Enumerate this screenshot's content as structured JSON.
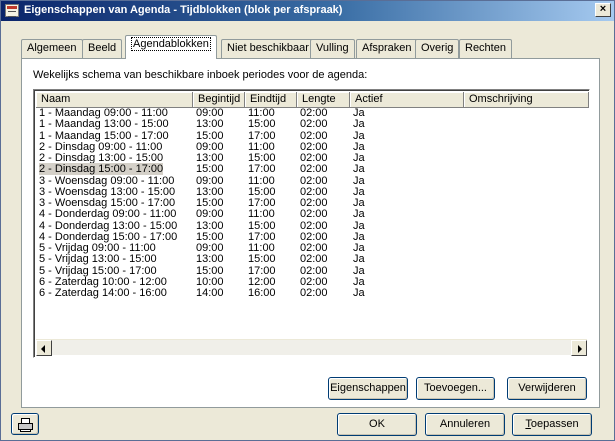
{
  "window": {
    "title": "Eigenschappen van Agenda - Tijdblokken (blok per afspraak)",
    "close_glyph": "×"
  },
  "tabs": [
    {
      "label": "Algemeen"
    },
    {
      "label": "Beeld"
    },
    {
      "label": "Agendablokken",
      "active": true
    },
    {
      "label": "Niet beschikbaar"
    },
    {
      "label": "Vulling"
    },
    {
      "label": "Afspraken"
    },
    {
      "label": "Overig"
    },
    {
      "label": "Rechten"
    }
  ],
  "panel": {
    "caption": "Wekelijks schema van beschikbare inboek periodes voor de agenda:"
  },
  "list": {
    "columns": [
      "Naam",
      "Begintijd",
      "Eindtijd",
      "Lengte",
      "Actief",
      "Omschrijving"
    ],
    "selected_row_index": 5,
    "rows": [
      [
        "1 - Maandag 09:00 - 11:00",
        "09:00",
        "11:00",
        "02:00",
        "Ja",
        ""
      ],
      [
        "1 - Maandag 13:00 - 15:00",
        "13:00",
        "15:00",
        "02:00",
        "Ja",
        ""
      ],
      [
        "1 - Maandag 15:00 - 17:00",
        "15:00",
        "17:00",
        "02:00",
        "Ja",
        ""
      ],
      [
        "2 - Dinsdag 09:00 - 11:00",
        "09:00",
        "11:00",
        "02:00",
        "Ja",
        ""
      ],
      [
        "2 - Dinsdag 13:00 - 15:00",
        "13:00",
        "15:00",
        "02:00",
        "Ja",
        ""
      ],
      [
        "2 - Dinsdag 15:00 - 17:00",
        "15:00",
        "17:00",
        "02:00",
        "Ja",
        ""
      ],
      [
        "3 - Woensdag 09:00 - 11:00",
        "09:00",
        "11:00",
        "02:00",
        "Ja",
        ""
      ],
      [
        "3 - Woensdag 13:00 - 15:00",
        "13:00",
        "15:00",
        "02:00",
        "Ja",
        ""
      ],
      [
        "3 - Woensdag 15:00 - 17:00",
        "15:00",
        "17:00",
        "02:00",
        "Ja",
        ""
      ],
      [
        "4 - Donderdag 09:00 - 11:00",
        "09:00",
        "11:00",
        "02:00",
        "Ja",
        ""
      ],
      [
        "4 - Donderdag 13:00 - 15:00",
        "13:00",
        "15:00",
        "02:00",
        "Ja",
        ""
      ],
      [
        "4 - Donderdag 15:00 - 17:00",
        "15:00",
        "17:00",
        "02:00",
        "Ja",
        ""
      ],
      [
        "5 - Vrijdag 09:00 - 11:00",
        "09:00",
        "11:00",
        "02:00",
        "Ja",
        ""
      ],
      [
        "5 - Vrijdag 13:00 - 15:00",
        "13:00",
        "15:00",
        "02:00",
        "Ja",
        ""
      ],
      [
        "5 - Vrijdag 15:00 - 17:00",
        "15:00",
        "17:00",
        "02:00",
        "Ja",
        ""
      ],
      [
        "6 - Zaterdag 10:00 - 12:00",
        "10:00",
        "12:00",
        "02:00",
        "Ja",
        ""
      ],
      [
        "6 - Zaterdag 14:00 - 16:00",
        "14:00",
        "16:00",
        "02:00",
        "Ja",
        ""
      ]
    ]
  },
  "actions": {
    "properties_label": "Eigenschappen",
    "add_label": "Toevoegen...",
    "delete_label": "Verwijderen"
  },
  "footer": {
    "ok_label": "OK",
    "cancel_label": "Annuleren",
    "apply_label": "Toepassen",
    "apply_mnemonic": "T",
    "apply_rest": "oepassen"
  },
  "icons": {
    "window": "agenda-icon",
    "printer": "printer-icon",
    "scroll_left": "arrow-left-icon",
    "scroll_right": "arrow-right-icon"
  }
}
